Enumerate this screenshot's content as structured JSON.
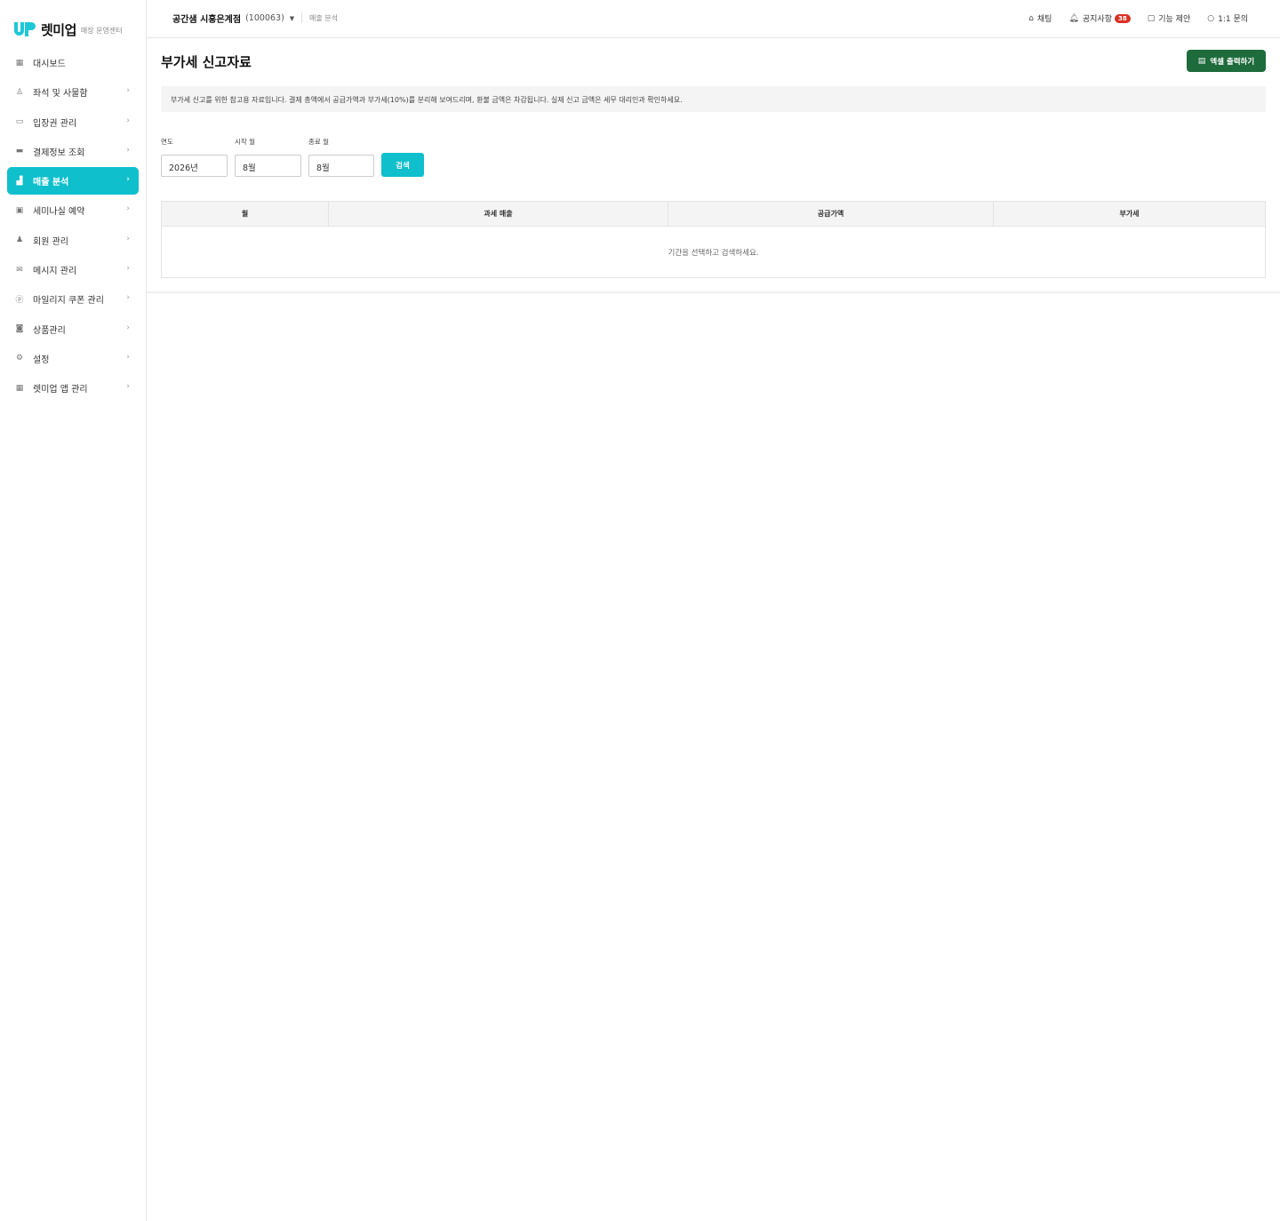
{
  "brand": {
    "name": "렛미업",
    "subtitle": "매장 운영센터",
    "accent": "#0fbfcc"
  },
  "sidebar": {
    "items": [
      {
        "label": "대시보드",
        "icon": "grid-icon",
        "has_chevron": false,
        "active": false
      },
      {
        "label": "좌석 및 사물함",
        "icon": "seat-icon",
        "has_chevron": true,
        "active": false
      },
      {
        "label": "입장권 관리",
        "icon": "ticket-icon",
        "has_chevron": true,
        "active": false
      },
      {
        "label": "결제정보 조회",
        "icon": "card-icon",
        "has_chevron": true,
        "active": false
      },
      {
        "label": "매출 분석",
        "icon": "chart-icon",
        "has_chevron": true,
        "active": true
      },
      {
        "label": "세미나실 예약",
        "icon": "calendar-icon",
        "has_chevron": true,
        "active": false
      },
      {
        "label": "회원 관리",
        "icon": "users-icon",
        "has_chevron": true,
        "active": false
      },
      {
        "label": "메시지 관리",
        "icon": "mail-icon",
        "has_chevron": true,
        "active": false
      },
      {
        "label": "마일리지 쿠폰 관리",
        "icon": "coin-icon",
        "has_chevron": true,
        "active": false
      },
      {
        "label": "상품관리",
        "icon": "bag-icon",
        "has_chevron": true,
        "active": false
      },
      {
        "label": "설정",
        "icon": "gear-icon",
        "has_chevron": true,
        "active": false
      },
      {
        "label": "렛미업 앱 관리",
        "icon": "apps-icon",
        "has_chevron": true,
        "active": false
      }
    ]
  },
  "header": {
    "store_name": "공간샘 시흥은계점",
    "store_code": "(100063)",
    "breadcrumb": "매출 분석",
    "actions": {
      "chat": "채팅",
      "notice": "공지사항",
      "notice_count": "38",
      "suggest": "기능 제안",
      "inquiry": "1:1 문의"
    }
  },
  "main": {
    "title": "부가세 신고자료",
    "excel_button": "엑셀 출력하기",
    "notice": "부가세 신고를 위한 참고용 자료입니다. 결제 총액에서 공급가액과 부가세(10%)를 분리해 보여드리며, 환불 금액은 차감됩니다. 실제 신고 금액은 세무 대리인과 확인하세요.",
    "filters": {
      "year_label": "연도",
      "year_value": "2026년",
      "start_label": "시작 월",
      "start_value": "8월",
      "end_label": "종료 월",
      "end_value": "8월",
      "search_button": "검색"
    },
    "table": {
      "columns": [
        "월",
        "과세 매출",
        "공급가액",
        "부가세"
      ],
      "empty_message": "기간을 선택하고 검색하세요."
    }
  }
}
